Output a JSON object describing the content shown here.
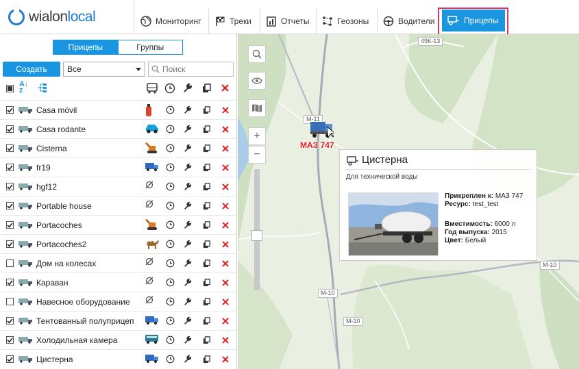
{
  "brand": {
    "part1": "wialon",
    "part2": "local"
  },
  "nav": [
    {
      "id": "monitoring",
      "label": "Мониторинг",
      "icon": "globe-icon"
    },
    {
      "id": "tracks",
      "label": "Треки",
      "icon": "flag-icon"
    },
    {
      "id": "reports",
      "label": "Отчеты",
      "icon": "report-icon"
    },
    {
      "id": "geofences",
      "label": "Геозоны",
      "icon": "geofence-icon"
    },
    {
      "id": "drivers",
      "label": "Водители",
      "icon": "steering-wheel-icon"
    },
    {
      "id": "trailers",
      "label": "Прицепы",
      "icon": "trailer-icon",
      "active": true
    }
  ],
  "panel": {
    "tabs": [
      "Прицепы",
      "Группы"
    ],
    "active_tab": "Прицепы",
    "create_label": "Создать",
    "filter_value": "Все",
    "search_placeholder": "Поиск"
  },
  "trailers": [
    {
      "name": "Casa móvil",
      "checked": true,
      "unit": "fire-extinguisher-icon"
    },
    {
      "name": "Casa rodante",
      "checked": true,
      "unit": "car-icon"
    },
    {
      "name": "Cisterna",
      "checked": true,
      "unit": "excavator-icon"
    },
    {
      "name": "fr19",
      "checked": true,
      "unit": "truck-icon"
    },
    {
      "name": "hgf12",
      "checked": true,
      "unit": "unlinked-icon"
    },
    {
      "name": "Portable house",
      "checked": true,
      "unit": "unlinked-icon"
    },
    {
      "name": "Portacoches",
      "checked": true,
      "unit": "excavator-icon"
    },
    {
      "name": "Portacoches2",
      "checked": true,
      "unit": "camel-icon"
    },
    {
      "name": "Дом на колесах",
      "checked": false,
      "unit": "unlinked-icon"
    },
    {
      "name": "Караван",
      "checked": true,
      "unit": "unlinked-icon"
    },
    {
      "name": "Навесное оборудование",
      "checked": false,
      "unit": "unlinked-icon"
    },
    {
      "name": "Тентованный полуприцеп",
      "checked": true,
      "unit": "truck-icon"
    },
    {
      "name": "Холодильная камера",
      "checked": true,
      "unit": "bus-icon"
    },
    {
      "name": "Цистерна",
      "checked": true,
      "unit": "truck-icon"
    }
  ],
  "map": {
    "road_labels": [
      "49К-13",
      "М-11",
      "М-10",
      "М-10",
      "М-10"
    ],
    "unit_label": "МАЗ 747"
  },
  "popup": {
    "title": "Цистерна",
    "description": "Для технической воды",
    "attached_label": "Прикреплен к:",
    "attached_value": "МАЗ 747",
    "resource_label": "Ресурс:",
    "resource_value": "test_test",
    "capacity_label": "Вместимость:",
    "capacity_value": "6000 л",
    "year_label": "Год выпуска:",
    "year_value": "2015",
    "color_label": "Цвет:",
    "color_value": "Белый"
  },
  "colors": {
    "accent": "#1a96e0",
    "delete": "#e02020",
    "highlight": "#e0306e"
  }
}
